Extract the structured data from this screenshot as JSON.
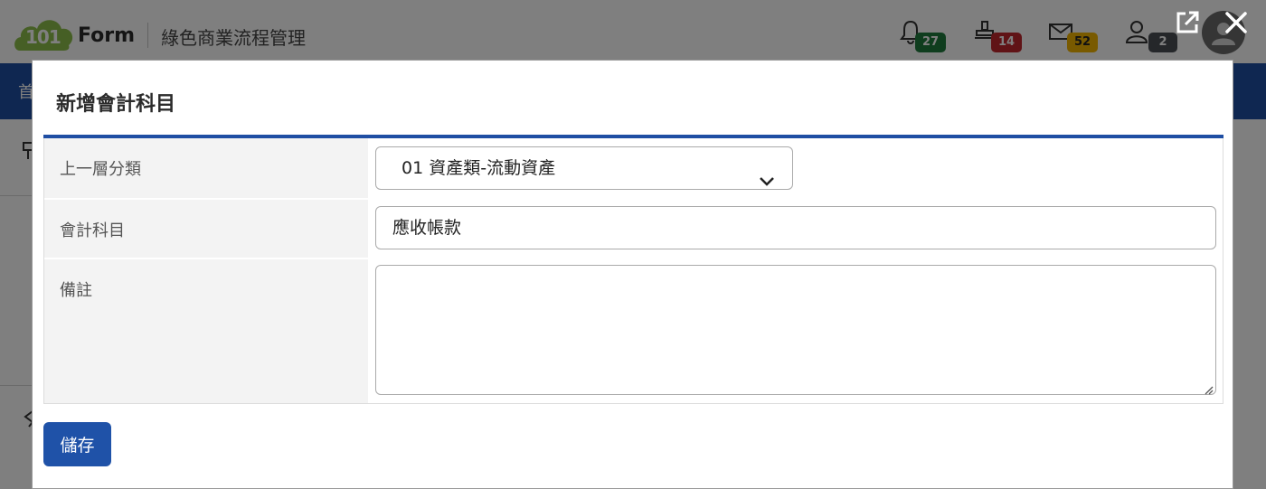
{
  "header": {
    "logo_number": "101",
    "logo_text": "Form",
    "tagline": "綠色商業流程管理",
    "badges": [
      {
        "icon": "bell-icon",
        "count": "27",
        "color": "#1e7a3c"
      },
      {
        "icon": "stamp-icon",
        "count": "14",
        "color": "#c0262d"
      },
      {
        "icon": "mail-icon",
        "count": "52",
        "color": "#f2b400"
      },
      {
        "icon": "user-icon",
        "count": "2",
        "color": "#4a4f55"
      }
    ]
  },
  "nav": {
    "first_item": "首"
  },
  "overlay_controls": {
    "popout": "popout-icon",
    "close": "close-icon"
  },
  "modal": {
    "title": "新增會計科目",
    "rows": [
      {
        "label": "上一層分類",
        "type": "select",
        "value": "01 資產類-流動資產"
      },
      {
        "label": "會計科目",
        "type": "input",
        "value": "應收帳款"
      },
      {
        "label": "備註",
        "type": "textarea",
        "value": ""
      }
    ],
    "save_label": "儲存"
  },
  "colors": {
    "primary": "#1f4ea3",
    "label_bg": "#f3f3f3"
  }
}
